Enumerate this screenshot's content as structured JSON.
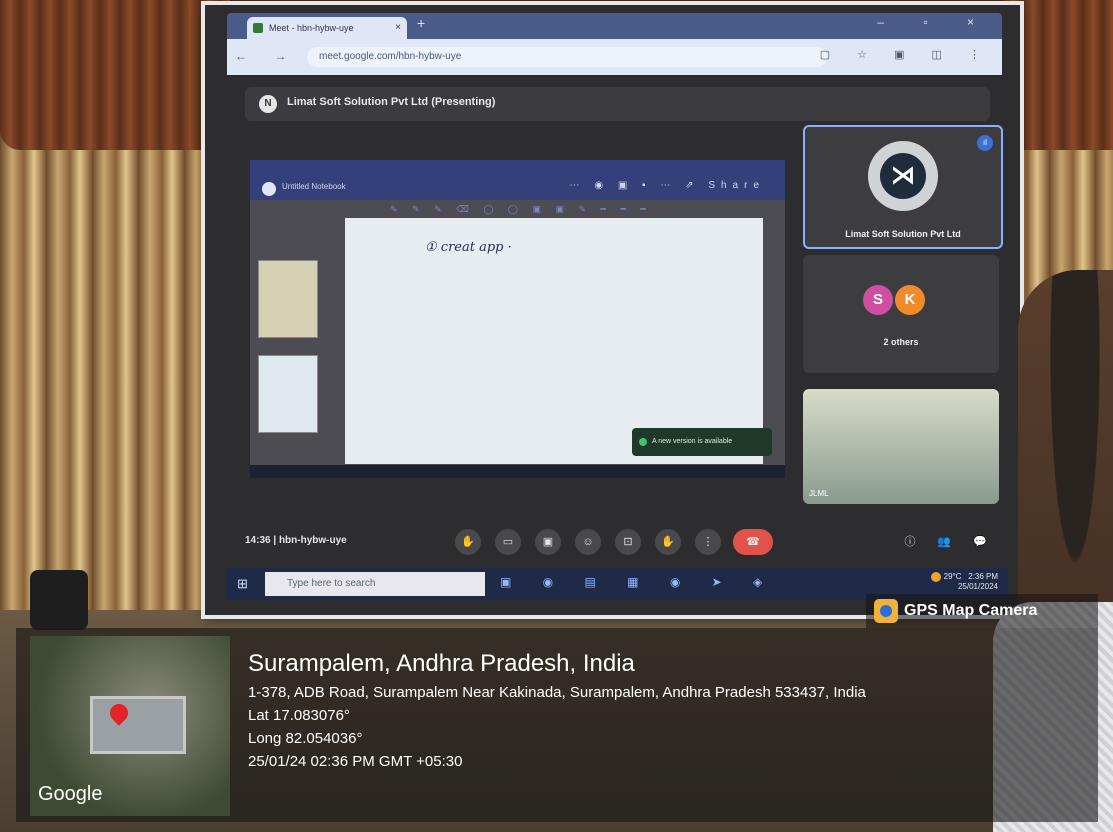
{
  "browser": {
    "tab_title": "Meet - hbn-hybw-uye",
    "tab_close": "×",
    "new_tab": "+",
    "window_controls": "– ▫ ×",
    "url": "meet.google.com/hbn-hybw-uye",
    "nav_icons": "← → ⟳",
    "toolbar_icons": "▢ ☆ ▣ ◫ ⋮"
  },
  "meet": {
    "presenter_title": "Limat Soft Solution Pvt Ltd (Presenting)",
    "presenter_logo": "N",
    "notebook_title": "Untitled Notebook",
    "notebook_tools": "⋯ ◉ ▣ ▪ ⋯ ⇗ Share",
    "pen_tools": "✎ ✎ ✎ ⌫ ◯ ◯ ▣ ▣ ✎ ━ ━ ━",
    "ink_text": "① creat app ·",
    "notice_text": "A new version is available",
    "participants": {
      "main_name": "Limat Soft Solution Pvt Ltd",
      "main_initial": "⋊",
      "others_initials": [
        "S",
        "K"
      ],
      "others_label": "2 others",
      "room_label": "JLML"
    },
    "time": "14:36",
    "meeting_code": "hbn-hybw-uye",
    "controls": [
      "✋",
      "▭",
      "▣",
      "☺",
      "⊡",
      "✋",
      "⋮"
    ],
    "end_call": "☎",
    "right_controls": [
      "ⓘ",
      "👥",
      "💬"
    ]
  },
  "taskbar": {
    "start": "⊞",
    "search_placeholder": "Type here to search",
    "apps": "▣ ◉ ▤ ▦ ◉ ➤ ◈",
    "weather": "29°C",
    "time": "2:36 PM",
    "date": "25/01/2024"
  },
  "gps": {
    "brand": "GPS Map Camera",
    "place": "Surampalem, Andhra Pradesh, India",
    "address": "1-378, ADB Road, Surampalem Near Kakinada, Surampalem, Andhra Pradesh 533437, India",
    "lat": "Lat 17.083076°",
    "long": "Long 82.054036°",
    "datetime": "25/01/24 02:36 PM GMT +05:30",
    "map_brand": "Google"
  }
}
